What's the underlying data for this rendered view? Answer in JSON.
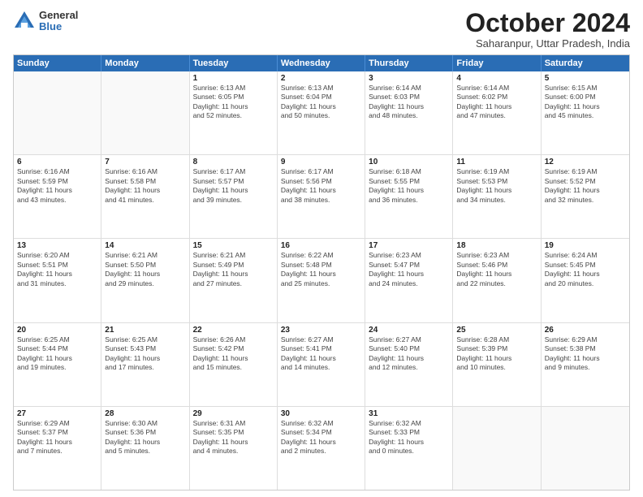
{
  "logo": {
    "general": "General",
    "blue": "Blue"
  },
  "title": "October 2024",
  "location": "Saharanpur, Uttar Pradesh, India",
  "weekdays": [
    "Sunday",
    "Monday",
    "Tuesday",
    "Wednesday",
    "Thursday",
    "Friday",
    "Saturday"
  ],
  "rows": [
    [
      {
        "day": "",
        "info": ""
      },
      {
        "day": "",
        "info": ""
      },
      {
        "day": "1",
        "info": "Sunrise: 6:13 AM\nSunset: 6:05 PM\nDaylight: 11 hours\nand 52 minutes."
      },
      {
        "day": "2",
        "info": "Sunrise: 6:13 AM\nSunset: 6:04 PM\nDaylight: 11 hours\nand 50 minutes."
      },
      {
        "day": "3",
        "info": "Sunrise: 6:14 AM\nSunset: 6:03 PM\nDaylight: 11 hours\nand 48 minutes."
      },
      {
        "day": "4",
        "info": "Sunrise: 6:14 AM\nSunset: 6:02 PM\nDaylight: 11 hours\nand 47 minutes."
      },
      {
        "day": "5",
        "info": "Sunrise: 6:15 AM\nSunset: 6:00 PM\nDaylight: 11 hours\nand 45 minutes."
      }
    ],
    [
      {
        "day": "6",
        "info": "Sunrise: 6:16 AM\nSunset: 5:59 PM\nDaylight: 11 hours\nand 43 minutes."
      },
      {
        "day": "7",
        "info": "Sunrise: 6:16 AM\nSunset: 5:58 PM\nDaylight: 11 hours\nand 41 minutes."
      },
      {
        "day": "8",
        "info": "Sunrise: 6:17 AM\nSunset: 5:57 PM\nDaylight: 11 hours\nand 39 minutes."
      },
      {
        "day": "9",
        "info": "Sunrise: 6:17 AM\nSunset: 5:56 PM\nDaylight: 11 hours\nand 38 minutes."
      },
      {
        "day": "10",
        "info": "Sunrise: 6:18 AM\nSunset: 5:55 PM\nDaylight: 11 hours\nand 36 minutes."
      },
      {
        "day": "11",
        "info": "Sunrise: 6:19 AM\nSunset: 5:53 PM\nDaylight: 11 hours\nand 34 minutes."
      },
      {
        "day": "12",
        "info": "Sunrise: 6:19 AM\nSunset: 5:52 PM\nDaylight: 11 hours\nand 32 minutes."
      }
    ],
    [
      {
        "day": "13",
        "info": "Sunrise: 6:20 AM\nSunset: 5:51 PM\nDaylight: 11 hours\nand 31 minutes."
      },
      {
        "day": "14",
        "info": "Sunrise: 6:21 AM\nSunset: 5:50 PM\nDaylight: 11 hours\nand 29 minutes."
      },
      {
        "day": "15",
        "info": "Sunrise: 6:21 AM\nSunset: 5:49 PM\nDaylight: 11 hours\nand 27 minutes."
      },
      {
        "day": "16",
        "info": "Sunrise: 6:22 AM\nSunset: 5:48 PM\nDaylight: 11 hours\nand 25 minutes."
      },
      {
        "day": "17",
        "info": "Sunrise: 6:23 AM\nSunset: 5:47 PM\nDaylight: 11 hours\nand 24 minutes."
      },
      {
        "day": "18",
        "info": "Sunrise: 6:23 AM\nSunset: 5:46 PM\nDaylight: 11 hours\nand 22 minutes."
      },
      {
        "day": "19",
        "info": "Sunrise: 6:24 AM\nSunset: 5:45 PM\nDaylight: 11 hours\nand 20 minutes."
      }
    ],
    [
      {
        "day": "20",
        "info": "Sunrise: 6:25 AM\nSunset: 5:44 PM\nDaylight: 11 hours\nand 19 minutes."
      },
      {
        "day": "21",
        "info": "Sunrise: 6:25 AM\nSunset: 5:43 PM\nDaylight: 11 hours\nand 17 minutes."
      },
      {
        "day": "22",
        "info": "Sunrise: 6:26 AM\nSunset: 5:42 PM\nDaylight: 11 hours\nand 15 minutes."
      },
      {
        "day": "23",
        "info": "Sunrise: 6:27 AM\nSunset: 5:41 PM\nDaylight: 11 hours\nand 14 minutes."
      },
      {
        "day": "24",
        "info": "Sunrise: 6:27 AM\nSunset: 5:40 PM\nDaylight: 11 hours\nand 12 minutes."
      },
      {
        "day": "25",
        "info": "Sunrise: 6:28 AM\nSunset: 5:39 PM\nDaylight: 11 hours\nand 10 minutes."
      },
      {
        "day": "26",
        "info": "Sunrise: 6:29 AM\nSunset: 5:38 PM\nDaylight: 11 hours\nand 9 minutes."
      }
    ],
    [
      {
        "day": "27",
        "info": "Sunrise: 6:29 AM\nSunset: 5:37 PM\nDaylight: 11 hours\nand 7 minutes."
      },
      {
        "day": "28",
        "info": "Sunrise: 6:30 AM\nSunset: 5:36 PM\nDaylight: 11 hours\nand 5 minutes."
      },
      {
        "day": "29",
        "info": "Sunrise: 6:31 AM\nSunset: 5:35 PM\nDaylight: 11 hours\nand 4 minutes."
      },
      {
        "day": "30",
        "info": "Sunrise: 6:32 AM\nSunset: 5:34 PM\nDaylight: 11 hours\nand 2 minutes."
      },
      {
        "day": "31",
        "info": "Sunrise: 6:32 AM\nSunset: 5:33 PM\nDaylight: 11 hours\nand 0 minutes."
      },
      {
        "day": "",
        "info": ""
      },
      {
        "day": "",
        "info": ""
      }
    ]
  ]
}
